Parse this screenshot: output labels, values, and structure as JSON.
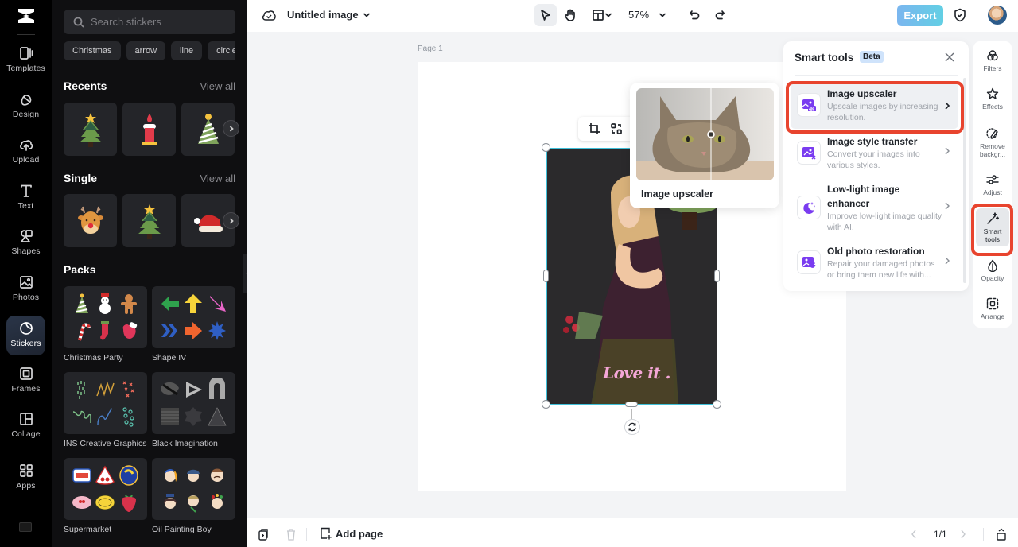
{
  "rail": {
    "items": [
      {
        "label": "Templates",
        "icon": "templates-icon"
      },
      {
        "label": "Design",
        "icon": "design-icon"
      },
      {
        "label": "Upload",
        "icon": "upload-icon"
      },
      {
        "label": "Text",
        "icon": "text-icon"
      },
      {
        "label": "Shapes",
        "icon": "shapes-icon"
      },
      {
        "label": "Photos",
        "icon": "photos-icon"
      },
      {
        "label": "Stickers",
        "icon": "stickers-icon",
        "active": true
      },
      {
        "label": "Frames",
        "icon": "frames-icon"
      },
      {
        "label": "Collage",
        "icon": "collage-icon"
      },
      {
        "label": "Apps",
        "icon": "apps-icon"
      }
    ]
  },
  "stickers": {
    "search_placeholder": "Search stickers",
    "chips": [
      "Christmas",
      "arrow",
      "line",
      "circle"
    ],
    "recents": {
      "title": "Recents",
      "view_all": "View all",
      "items": [
        "christmas-tree",
        "candle",
        "party-hat"
      ]
    },
    "single": {
      "title": "Single",
      "view_all": "View all",
      "items": [
        "reindeer",
        "christmas-tree",
        "santa-hat"
      ]
    },
    "packs": {
      "title": "Packs",
      "items": [
        {
          "name": "Christmas Party"
        },
        {
          "name": "Shape IV"
        },
        {
          "name": "INS Creative Graphics"
        },
        {
          "name": "Black Imagination"
        },
        {
          "name": "Supermarket"
        },
        {
          "name": "Oil Painting Boy"
        }
      ]
    }
  },
  "topbar": {
    "title": "Untitled image",
    "zoom": "57%",
    "export_label": "Export"
  },
  "canvas": {
    "page_label": "Page 1",
    "overlay_text": "Love it ."
  },
  "preview": {
    "caption": "Image upscaler"
  },
  "smart_tools": {
    "title": "Smart tools",
    "badge": "Beta",
    "items": [
      {
        "name": "Image upscaler",
        "desc": "Upscale images by increasing resolution.",
        "highlighted": true
      },
      {
        "name": "Image style transfer",
        "desc": "Convert your images into various styles."
      },
      {
        "name": "Low-light image enhancer",
        "desc": "Improve low-light image quality with AI."
      },
      {
        "name": "Old photo restoration",
        "desc": "Repair your damaged photos or bring them new life with..."
      }
    ]
  },
  "properties": {
    "items": [
      {
        "label": "Filters"
      },
      {
        "label": "Effects"
      },
      {
        "label": "Remove backgr..."
      },
      {
        "label": "Adjust"
      },
      {
        "label": "Smart tools",
        "active": true
      },
      {
        "label": "Opacity"
      },
      {
        "label": "Arrange"
      }
    ]
  },
  "bottombar": {
    "add_page": "Add page",
    "page_count": "1/1"
  },
  "colors": {
    "accent": "#3fbfd8",
    "highlight_box": "#e8442e",
    "icon_purple": "#7a3cf0"
  }
}
